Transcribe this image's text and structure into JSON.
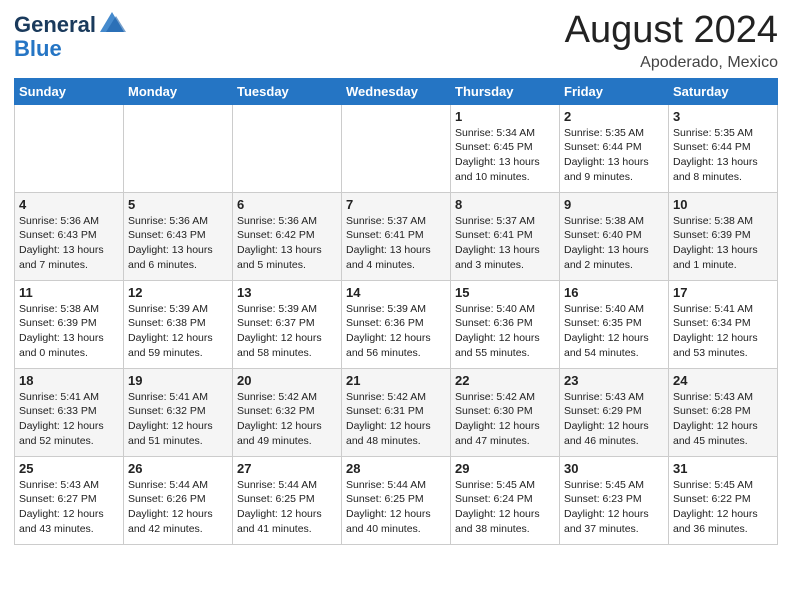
{
  "header": {
    "logo_general": "General",
    "logo_blue": "Blue",
    "month_year": "August 2024",
    "location": "Apoderado, Mexico"
  },
  "days_of_week": [
    "Sunday",
    "Monday",
    "Tuesday",
    "Wednesday",
    "Thursday",
    "Friday",
    "Saturday"
  ],
  "weeks": [
    [
      {
        "day": "",
        "info": ""
      },
      {
        "day": "",
        "info": ""
      },
      {
        "day": "",
        "info": ""
      },
      {
        "day": "",
        "info": ""
      },
      {
        "day": "1",
        "info": "Sunrise: 5:34 AM\nSunset: 6:45 PM\nDaylight: 13 hours\nand 10 minutes."
      },
      {
        "day": "2",
        "info": "Sunrise: 5:35 AM\nSunset: 6:44 PM\nDaylight: 13 hours\nand 9 minutes."
      },
      {
        "day": "3",
        "info": "Sunrise: 5:35 AM\nSunset: 6:44 PM\nDaylight: 13 hours\nand 8 minutes."
      }
    ],
    [
      {
        "day": "4",
        "info": "Sunrise: 5:36 AM\nSunset: 6:43 PM\nDaylight: 13 hours\nand 7 minutes."
      },
      {
        "day": "5",
        "info": "Sunrise: 5:36 AM\nSunset: 6:43 PM\nDaylight: 13 hours\nand 6 minutes."
      },
      {
        "day": "6",
        "info": "Sunrise: 5:36 AM\nSunset: 6:42 PM\nDaylight: 13 hours\nand 5 minutes."
      },
      {
        "day": "7",
        "info": "Sunrise: 5:37 AM\nSunset: 6:41 PM\nDaylight: 13 hours\nand 4 minutes."
      },
      {
        "day": "8",
        "info": "Sunrise: 5:37 AM\nSunset: 6:41 PM\nDaylight: 13 hours\nand 3 minutes."
      },
      {
        "day": "9",
        "info": "Sunrise: 5:38 AM\nSunset: 6:40 PM\nDaylight: 13 hours\nand 2 minutes."
      },
      {
        "day": "10",
        "info": "Sunrise: 5:38 AM\nSunset: 6:39 PM\nDaylight: 13 hours\nand 1 minute."
      }
    ],
    [
      {
        "day": "11",
        "info": "Sunrise: 5:38 AM\nSunset: 6:39 PM\nDaylight: 13 hours\nand 0 minutes."
      },
      {
        "day": "12",
        "info": "Sunrise: 5:39 AM\nSunset: 6:38 PM\nDaylight: 12 hours\nand 59 minutes."
      },
      {
        "day": "13",
        "info": "Sunrise: 5:39 AM\nSunset: 6:37 PM\nDaylight: 12 hours\nand 58 minutes."
      },
      {
        "day": "14",
        "info": "Sunrise: 5:39 AM\nSunset: 6:36 PM\nDaylight: 12 hours\nand 56 minutes."
      },
      {
        "day": "15",
        "info": "Sunrise: 5:40 AM\nSunset: 6:36 PM\nDaylight: 12 hours\nand 55 minutes."
      },
      {
        "day": "16",
        "info": "Sunrise: 5:40 AM\nSunset: 6:35 PM\nDaylight: 12 hours\nand 54 minutes."
      },
      {
        "day": "17",
        "info": "Sunrise: 5:41 AM\nSunset: 6:34 PM\nDaylight: 12 hours\nand 53 minutes."
      }
    ],
    [
      {
        "day": "18",
        "info": "Sunrise: 5:41 AM\nSunset: 6:33 PM\nDaylight: 12 hours\nand 52 minutes."
      },
      {
        "day": "19",
        "info": "Sunrise: 5:41 AM\nSunset: 6:32 PM\nDaylight: 12 hours\nand 51 minutes."
      },
      {
        "day": "20",
        "info": "Sunrise: 5:42 AM\nSunset: 6:32 PM\nDaylight: 12 hours\nand 49 minutes."
      },
      {
        "day": "21",
        "info": "Sunrise: 5:42 AM\nSunset: 6:31 PM\nDaylight: 12 hours\nand 48 minutes."
      },
      {
        "day": "22",
        "info": "Sunrise: 5:42 AM\nSunset: 6:30 PM\nDaylight: 12 hours\nand 47 minutes."
      },
      {
        "day": "23",
        "info": "Sunrise: 5:43 AM\nSunset: 6:29 PM\nDaylight: 12 hours\nand 46 minutes."
      },
      {
        "day": "24",
        "info": "Sunrise: 5:43 AM\nSunset: 6:28 PM\nDaylight: 12 hours\nand 45 minutes."
      }
    ],
    [
      {
        "day": "25",
        "info": "Sunrise: 5:43 AM\nSunset: 6:27 PM\nDaylight: 12 hours\nand 43 minutes."
      },
      {
        "day": "26",
        "info": "Sunrise: 5:44 AM\nSunset: 6:26 PM\nDaylight: 12 hours\nand 42 minutes."
      },
      {
        "day": "27",
        "info": "Sunrise: 5:44 AM\nSunset: 6:25 PM\nDaylight: 12 hours\nand 41 minutes."
      },
      {
        "day": "28",
        "info": "Sunrise: 5:44 AM\nSunset: 6:25 PM\nDaylight: 12 hours\nand 40 minutes."
      },
      {
        "day": "29",
        "info": "Sunrise: 5:45 AM\nSunset: 6:24 PM\nDaylight: 12 hours\nand 38 minutes."
      },
      {
        "day": "30",
        "info": "Sunrise: 5:45 AM\nSunset: 6:23 PM\nDaylight: 12 hours\nand 37 minutes."
      },
      {
        "day": "31",
        "info": "Sunrise: 5:45 AM\nSunset: 6:22 PM\nDaylight: 12 hours\nand 36 minutes."
      }
    ]
  ]
}
